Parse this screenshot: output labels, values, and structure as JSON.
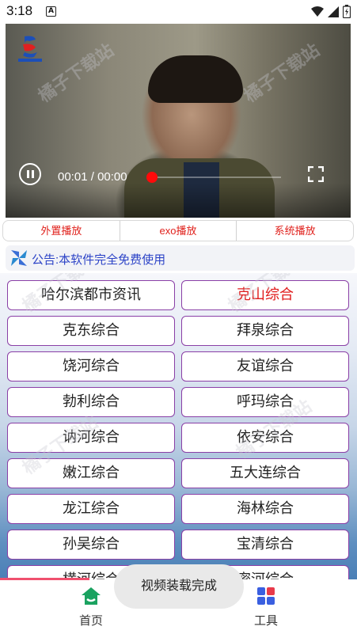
{
  "status_bar": {
    "time": "3:18",
    "notification_icon": "A"
  },
  "video": {
    "current_time": "00:01",
    "separator": "/",
    "duration": "00:00",
    "progress": 0
  },
  "player_tabs": [
    "外置播放",
    "exo播放",
    "系统播放"
  ],
  "notice": {
    "text": "公告:本软件完全免费使用"
  },
  "channels": [
    {
      "label": "哈尔滨都市资讯",
      "active": false
    },
    {
      "label": "克山综合",
      "active": true
    },
    {
      "label": "克东综合",
      "active": false
    },
    {
      "label": "拜泉综合",
      "active": false
    },
    {
      "label": "饶河综合",
      "active": false
    },
    {
      "label": "友谊综合",
      "active": false
    },
    {
      "label": "勃利综合",
      "active": false
    },
    {
      "label": "呼玛综合",
      "active": false
    },
    {
      "label": "讷河综合",
      "active": false
    },
    {
      "label": "依安综合",
      "active": false
    },
    {
      "label": "嫩江综合",
      "active": false
    },
    {
      "label": "五大连综合",
      "active": false
    },
    {
      "label": "龙江综合",
      "active": false
    },
    {
      "label": "海林综合",
      "active": false
    },
    {
      "label": "孙吴综合",
      "active": false
    },
    {
      "label": "宝清综合",
      "active": false
    },
    {
      "label": "横河综合",
      "active": false
    },
    {
      "label": "密河综合",
      "active": false
    }
  ],
  "toast": {
    "text": "视频装载完成"
  },
  "nav": {
    "home": "首页",
    "tools": "工具"
  },
  "watermark": "橘子下载站",
  "colors": {
    "accent_red": "#e01b1b",
    "notice_blue": "#2c43c7",
    "button_border": "#8a3fa6",
    "home_icon": "#1aa260"
  }
}
